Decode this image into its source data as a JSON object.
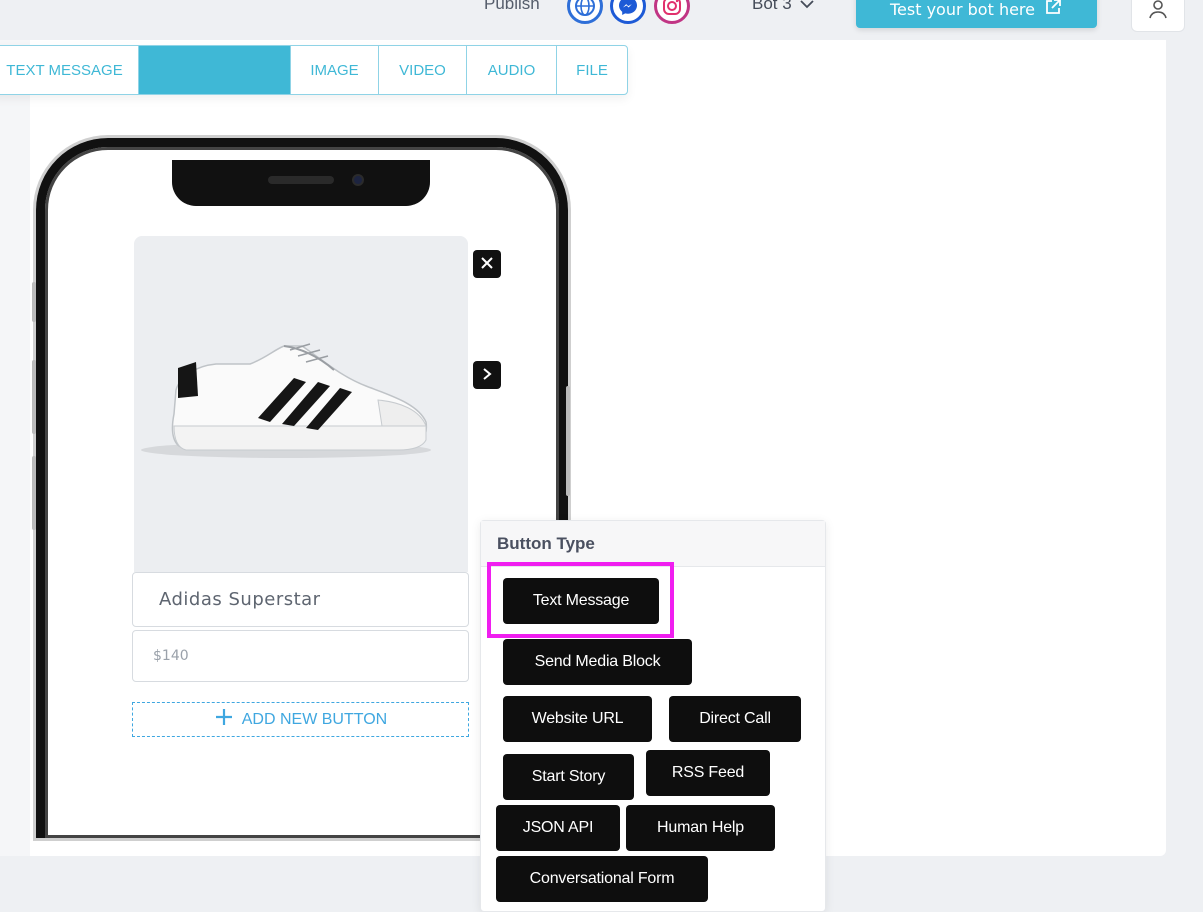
{
  "topbar": {
    "publish_label": "Publish",
    "channels": [
      "web-globe-icon",
      "messenger-icon",
      "instagram-icon"
    ],
    "bot_name": "Bot 3",
    "test_button_label": "Test your bot here"
  },
  "tabs": [
    "TEXT MESSAGE",
    "",
    "IMAGE",
    "VIDEO",
    "AUDIO",
    "FILE"
  ],
  "card": {
    "title": "Adidas Superstar",
    "price": "$140",
    "add_button_label": "ADD NEW BUTTON"
  },
  "popover": {
    "header": "Button Type",
    "buttons": [
      "Text Message",
      "Send Media Block",
      "Website URL",
      "Direct Call",
      "Start Story",
      "RSS Feed",
      "JSON API",
      "Human Help",
      "Conversational Form"
    ]
  },
  "colors": {
    "accent": "#3fb8d6",
    "highlight": "#f01ef0",
    "button_dark": "#0e0e0e"
  }
}
